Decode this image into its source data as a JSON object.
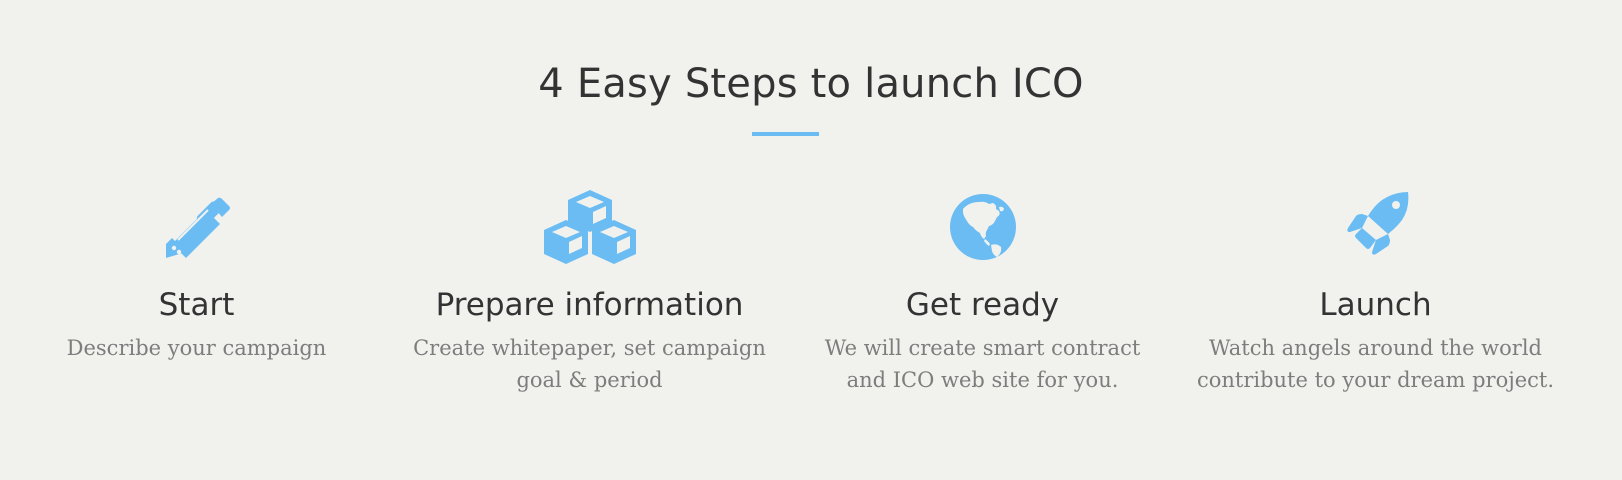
{
  "section": {
    "title": "4 Easy Steps to launch ICO",
    "accent_color": "#6bbcf3"
  },
  "steps": [
    {
      "icon": "pencil-icon",
      "title": "Start",
      "description_lines": [
        "Describe your campaign"
      ]
    },
    {
      "icon": "cubes-icon",
      "title": "Prepare information",
      "description_lines": [
        "Create whitepaper, set campaign",
        "goal & period"
      ]
    },
    {
      "icon": "globe-icon",
      "title": "Get ready",
      "description_lines": [
        "We will create smart contract",
        "and ICO web site for you."
      ]
    },
    {
      "icon": "rocket-icon",
      "title": "Launch",
      "description_lines": [
        "Watch angels around the world",
        "contribute to your dream project."
      ]
    }
  ]
}
